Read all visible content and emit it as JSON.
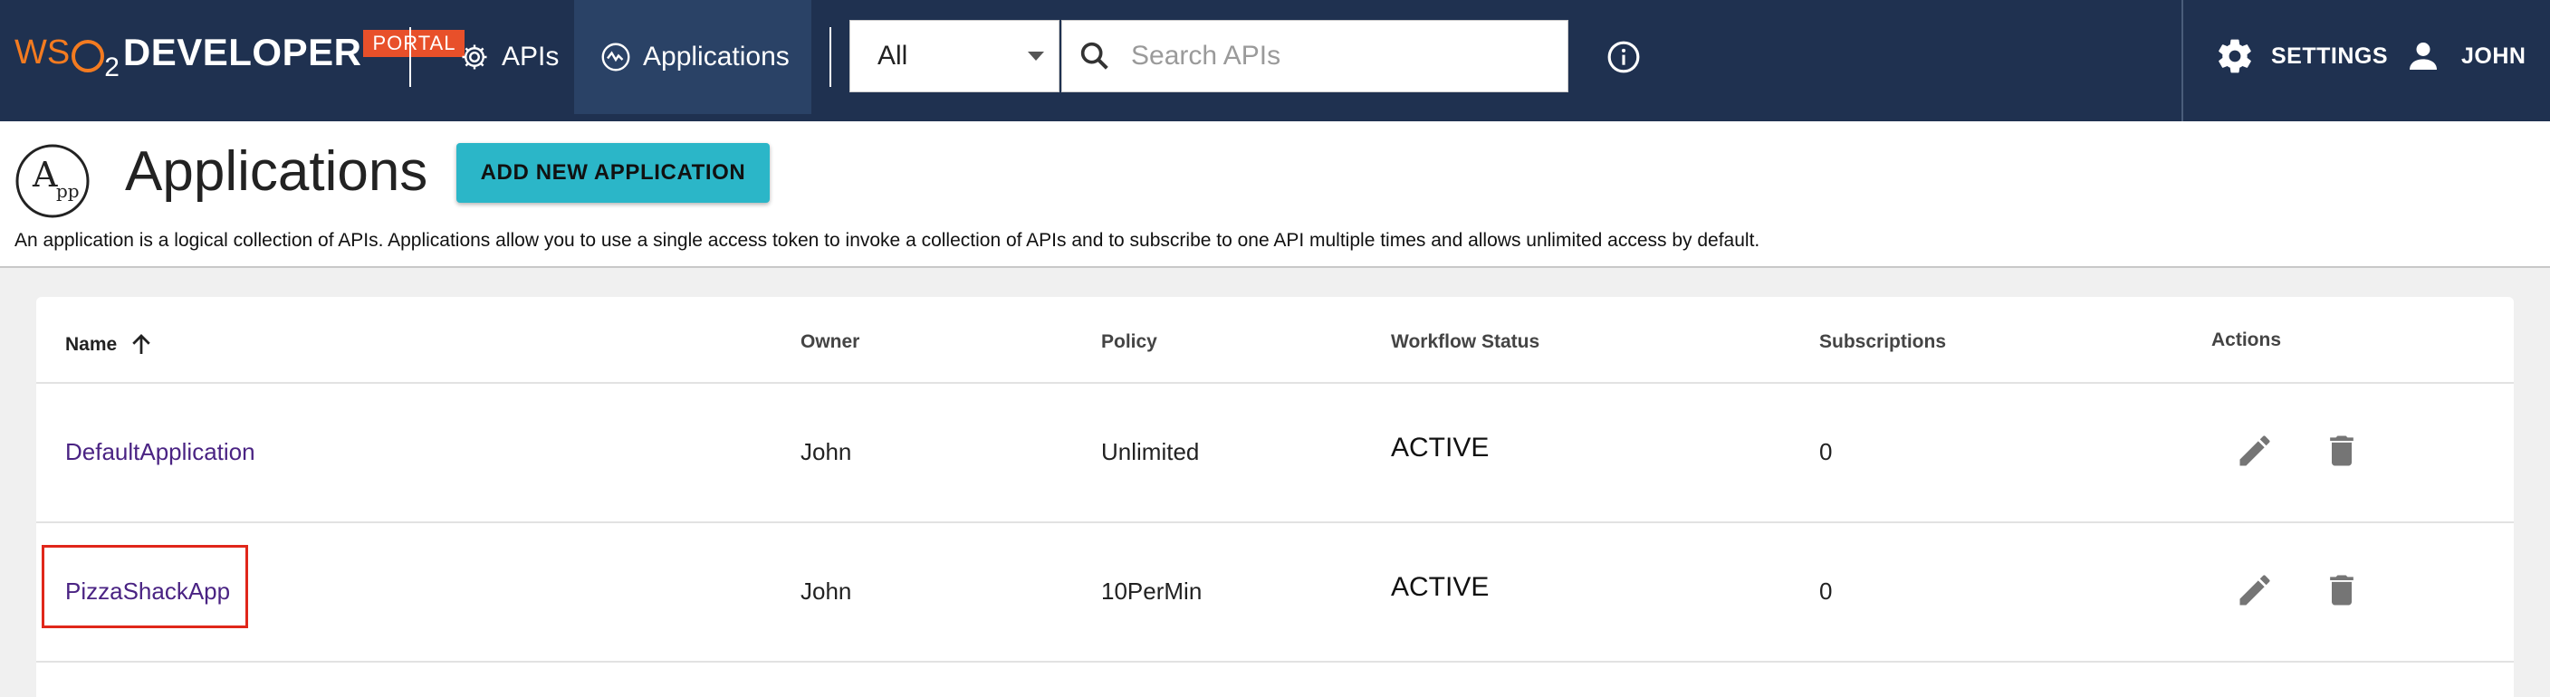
{
  "topbar": {
    "logo": {
      "brand_left": "WS",
      "brand_sub": "2",
      "product": "DEVELOPER",
      "badge": "PORTAL"
    },
    "nav": [
      {
        "label": "APIs",
        "icon": "apis-gear-icon"
      },
      {
        "label": "Applications",
        "icon": "applications-icon",
        "active": true
      }
    ],
    "search": {
      "filter_value": "All",
      "placeholder": "Search APIs"
    },
    "settings_label": "SETTINGS",
    "user_label": "JOHN"
  },
  "header": {
    "title": "Applications",
    "add_button": "ADD NEW APPLICATION",
    "description": "An application is a logical collection of APIs. Applications allow you to use a single access token to invoke a collection of APIs and to subscribe to one API multiple times and allows unlimited access by default."
  },
  "table": {
    "columns": [
      "Name",
      "Owner",
      "Policy",
      "Workflow Status",
      "Subscriptions",
      "Actions"
    ],
    "rows": [
      {
        "name": "DefaultApplication",
        "owner": "John",
        "policy": "Unlimited",
        "status": "ACTIVE",
        "subscriptions": "0"
      },
      {
        "name": "PizzaShackApp",
        "owner": "John",
        "policy": "10PerMin",
        "status": "ACTIVE",
        "subscriptions": "0"
      }
    ]
  },
  "colors": {
    "topbar": "#1f3150",
    "active_nav": "#2a4266",
    "accent_button": "#2bb6c8",
    "link": "#4a2383",
    "highlight": "#e0271a",
    "logo_orange": "#f47b20"
  }
}
